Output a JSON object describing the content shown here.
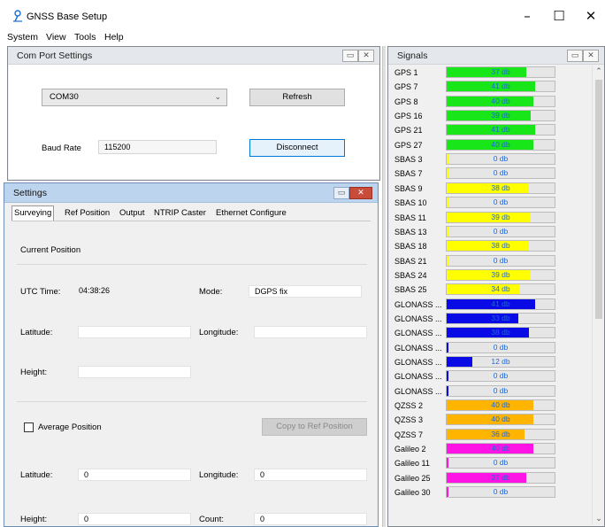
{
  "window": {
    "title": "GNSS Base Setup",
    "minimize": "–",
    "maximize": "☐",
    "close": "✕"
  },
  "menu": [
    "System",
    "View",
    "Tools",
    "Help"
  ],
  "com_port": {
    "title": "Com Port Settings",
    "port_value": "COM30",
    "refresh_label": "Refresh",
    "baud_label": "Baud Rate",
    "baud_value": "115200",
    "disconnect_label": "Disconnect"
  },
  "settings": {
    "title": "Settings",
    "tabs": [
      "Surveying",
      "Ref Position",
      "Output",
      "NTRIP Caster",
      "Ethernet Configure"
    ],
    "current_position_label": "Current Position",
    "utc_label": "UTC Time:",
    "utc_value": "04:38:26",
    "mode_label": "Mode:",
    "mode_value": "DGPS fix",
    "latitude_label": "Latitude:",
    "latitude_value": "",
    "longitude_label": "Longitude:",
    "longitude_value": "",
    "height_label": "Height:",
    "height_value": "",
    "average_label": "Average Position",
    "copy_label": "Copy to Ref Position",
    "avg_latitude_label": "Latitude:",
    "avg_latitude_value": "0",
    "avg_longitude_label": "Longitude:",
    "avg_longitude_value": "0",
    "avg_height_label": "Height:",
    "avg_height_value": "0",
    "count_label": "Count:",
    "count_value": "0"
  },
  "signals": {
    "title": "Signals",
    "max_db": 50,
    "colors": {
      "GPS": "#19e619",
      "SBAS": "#ffff00",
      "GLONASS": "#0a0ae6",
      "QZSS": "#ffb400",
      "Galileo": "#ff14e6"
    },
    "rows": [
      {
        "name": "GPS 1",
        "system": "GPS",
        "db": 37,
        "label": "37 db"
      },
      {
        "name": "GPS 7",
        "system": "GPS",
        "db": 41,
        "label": "41 db"
      },
      {
        "name": "GPS 8",
        "system": "GPS",
        "db": 40,
        "label": "40 db"
      },
      {
        "name": "GPS 16",
        "system": "GPS",
        "db": 39,
        "label": "39 db"
      },
      {
        "name": "GPS 21",
        "system": "GPS",
        "db": 41,
        "label": "41 db"
      },
      {
        "name": "GPS 27",
        "system": "GPS",
        "db": 40,
        "label": "40 db"
      },
      {
        "name": "SBAS 3",
        "system": "SBAS",
        "db": 0,
        "label": "0 db"
      },
      {
        "name": "SBAS 7",
        "system": "SBAS",
        "db": 0,
        "label": "0 db"
      },
      {
        "name": "SBAS 9",
        "system": "SBAS",
        "db": 38,
        "label": "38 db"
      },
      {
        "name": "SBAS 10",
        "system": "SBAS",
        "db": 0,
        "label": "0 db"
      },
      {
        "name": "SBAS 11",
        "system": "SBAS",
        "db": 39,
        "label": "39 db"
      },
      {
        "name": "SBAS 13",
        "system": "SBAS",
        "db": 0,
        "label": "0 db"
      },
      {
        "name": "SBAS 18",
        "system": "SBAS",
        "db": 38,
        "label": "38 db"
      },
      {
        "name": "SBAS 21",
        "system": "SBAS",
        "db": 0,
        "label": "0 db"
      },
      {
        "name": "SBAS 24",
        "system": "SBAS",
        "db": 39,
        "label": "39 db"
      },
      {
        "name": "SBAS 25",
        "system": "SBAS",
        "db": 34,
        "label": "34 db"
      },
      {
        "name": "GLONASS ...",
        "system": "GLONASS",
        "db": 41,
        "label": "41 db"
      },
      {
        "name": "GLONASS ...",
        "system": "GLONASS",
        "db": 33,
        "label": "33 db"
      },
      {
        "name": "GLONASS ...",
        "system": "GLONASS",
        "db": 38,
        "label": "38 db"
      },
      {
        "name": "GLONASS ...",
        "system": "GLONASS",
        "db": 0,
        "label": "0 db"
      },
      {
        "name": "GLONASS ...",
        "system": "GLONASS",
        "db": 12,
        "label": "12 db"
      },
      {
        "name": "GLONASS ...",
        "system": "GLONASS",
        "db": 0,
        "label": "0 db"
      },
      {
        "name": "GLONASS ...",
        "system": "GLONASS",
        "db": 0,
        "label": "0 db"
      },
      {
        "name": "QZSS 2",
        "system": "QZSS",
        "db": 40,
        "label": "40 db"
      },
      {
        "name": "QZSS 3",
        "system": "QZSS",
        "db": 40,
        "label": "40 db"
      },
      {
        "name": "QZSS 7",
        "system": "QZSS",
        "db": 36,
        "label": "36 db"
      },
      {
        "name": "Galileo 2",
        "system": "Galileo",
        "db": 40,
        "label": "40 db"
      },
      {
        "name": "Galileo 11",
        "system": "Galileo",
        "db": 0,
        "label": "0 db"
      },
      {
        "name": "Galileo 25",
        "system": "Galileo",
        "db": 37,
        "label": "37 db"
      },
      {
        "name": "Galileo 30",
        "system": "Galileo",
        "db": 0,
        "label": "0 db"
      }
    ]
  }
}
